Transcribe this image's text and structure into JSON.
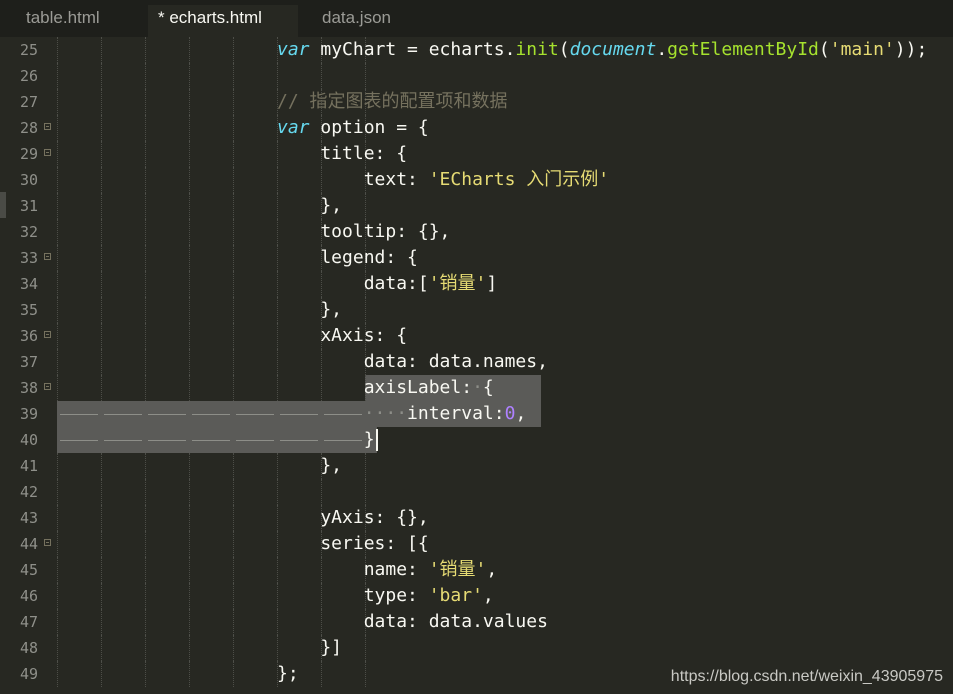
{
  "tabs": [
    {
      "label": "table.html",
      "active": false
    },
    {
      "label": "* echarts.html",
      "active": true
    },
    {
      "label": "data.json",
      "active": false
    }
  ],
  "colors": {
    "background": "#272822",
    "keyword": "#66d9ef",
    "function": "#a6e22e",
    "string": "#e6db74",
    "number": "#ae81ff",
    "comment": "#75715e",
    "selection": "#5b5b58"
  },
  "lines": [
    {
      "n": "25",
      "tokens": [
        {
          "t": "var",
          "c": "kw"
        },
        {
          "t": " myChart = echarts.",
          "c": "tok"
        },
        {
          "t": "init",
          "c": "fn"
        },
        {
          "t": "(",
          "c": "tok"
        },
        {
          "t": "document",
          "c": "kw"
        },
        {
          "t": ".",
          "c": "tok"
        },
        {
          "t": "getElementById",
          "c": "fn"
        },
        {
          "t": "(",
          "c": "tok"
        },
        {
          "t": "'main'",
          "c": "str"
        },
        {
          "t": "));",
          "c": "tok"
        }
      ]
    },
    {
      "n": "26",
      "tokens": []
    },
    {
      "n": "27",
      "tokens": [
        {
          "t": "// 指定图表的配置项和数据",
          "c": "cmt"
        }
      ]
    },
    {
      "n": "28",
      "fold": true,
      "tokens": [
        {
          "t": "var",
          "c": "kw"
        },
        {
          "t": " option = {",
          "c": "tok"
        }
      ]
    },
    {
      "n": "29",
      "fold": true,
      "tokens": [
        {
          "t": "    title: {",
          "c": "tok"
        }
      ]
    },
    {
      "n": "30",
      "tokens": [
        {
          "t": "        text: ",
          "c": "tok"
        },
        {
          "t": "'ECharts 入门示例'",
          "c": "str"
        }
      ]
    },
    {
      "n": "31",
      "tokens": [
        {
          "t": "    },",
          "c": "tok"
        }
      ]
    },
    {
      "n": "32",
      "tokens": [
        {
          "t": "    tooltip: {},",
          "c": "tok"
        }
      ]
    },
    {
      "n": "33",
      "fold": true,
      "tokens": [
        {
          "t": "    legend: {",
          "c": "tok"
        }
      ]
    },
    {
      "n": "34",
      "tokens": [
        {
          "t": "        data:[",
          "c": "tok"
        },
        {
          "t": "'销量'",
          "c": "str"
        },
        {
          "t": "]",
          "c": "tok"
        }
      ]
    },
    {
      "n": "35",
      "tokens": [
        {
          "t": "    },",
          "c": "tok"
        }
      ]
    },
    {
      "n": "36",
      "fold": true,
      "tokens": [
        {
          "t": "    xAxis: {",
          "c": "tok"
        }
      ]
    },
    {
      "n": "37",
      "tokens": [
        {
          "t": "        data: data.names,",
          "c": "tok"
        }
      ]
    },
    {
      "n": "38",
      "fold": true,
      "tokens": [
        {
          "t": "        axisLabel:",
          "c": "tok"
        },
        {
          "t": "·",
          "c": "ws"
        },
        {
          "t": "{",
          "c": "tok"
        }
      ]
    },
    {
      "n": "39",
      "tokens": [
        {
          "t": "        ····",
          "c": "ws"
        },
        {
          "t": "interval:",
          "c": "tok"
        },
        {
          "t": "0",
          "c": "num"
        },
        {
          "t": ",",
          "c": "tok"
        }
      ]
    },
    {
      "n": "40",
      "tokens": [
        {
          "t": "        }",
          "c": "tok"
        }
      ]
    },
    {
      "n": "41",
      "tokens": [
        {
          "t": "    },",
          "c": "tok"
        }
      ]
    },
    {
      "n": "42",
      "tokens": []
    },
    {
      "n": "43",
      "tokens": [
        {
          "t": "    yAxis: {},",
          "c": "tok"
        }
      ]
    },
    {
      "n": "44",
      "fold": true,
      "tokens": [
        {
          "t": "    series: [{",
          "c": "tok"
        }
      ]
    },
    {
      "n": "45",
      "tokens": [
        {
          "t": "        name: ",
          "c": "tok"
        },
        {
          "t": "'销量'",
          "c": "str"
        },
        {
          "t": ",",
          "c": "tok"
        }
      ]
    },
    {
      "n": "46",
      "tokens": [
        {
          "t": "        type: ",
          "c": "tok"
        },
        {
          "t": "'bar'",
          "c": "str"
        },
        {
          "t": ",",
          "c": "tok"
        }
      ]
    },
    {
      "n": "47",
      "tokens": [
        {
          "t": "        data: data.values",
          "c": "tok"
        }
      ]
    },
    {
      "n": "48",
      "tokens": [
        {
          "t": "    }]",
          "c": "tok"
        }
      ]
    },
    {
      "n": "49",
      "tokens": [
        {
          "t": "};",
          "c": "tok"
        }
      ]
    }
  ],
  "watermark": "https://blog.csdn.net/weixin_43905975"
}
